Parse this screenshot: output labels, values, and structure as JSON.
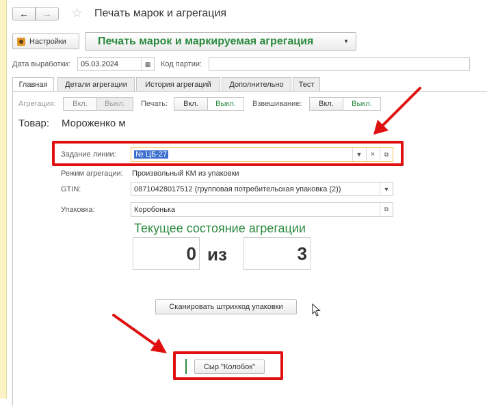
{
  "window": {
    "title": "Печать марок и агрегация"
  },
  "toolbar": {
    "settings_label": "Настройки",
    "mode_label": "Печать марок и маркируемая агрегация"
  },
  "params": {
    "production_date_label": "Дата выработки:",
    "production_date_value": "05.03.2024",
    "batch_code_label": "Код партии:",
    "batch_code_value": ""
  },
  "tabs": [
    {
      "label": "Главная"
    },
    {
      "label": "Детали агрегации"
    },
    {
      "label": "История агрегаций"
    },
    {
      "label": "Дополнительно"
    },
    {
      "label": "Тест"
    }
  ],
  "toggles": {
    "aggregation_label": "Агрегация:",
    "print_label": "Печать:",
    "weighing_label": "Взвешивание:",
    "on_label": "Вкл.",
    "off_label": "Выкл."
  },
  "product": {
    "label": "Товар:",
    "value": "Мороженко м"
  },
  "form": {
    "line_task_label": "Задание линии:",
    "line_task_value": "№ ЦБ-27",
    "aggregation_mode_label": "Режим агрегации:",
    "aggregation_mode_value": "Произвольный КМ из упаковки",
    "gtin_label": "GTIN:",
    "gtin_value": "08710428017512 (групповая потребительская упаковка (2))",
    "package_label": "Упаковка:",
    "package_value": "Коробонька"
  },
  "aggregation_state": {
    "title": "Текущее состояние агрегации",
    "current": "0",
    "of_label": "из",
    "total": "3"
  },
  "actions": {
    "scan_label": "Сканировать штрихкод упаковки",
    "product_button_label": "Сыр \"Колобок\""
  },
  "colors": {
    "accent_green": "#2b8a3e",
    "highlight_red": "#e01010",
    "selection_blue": "#3d6fcf"
  }
}
